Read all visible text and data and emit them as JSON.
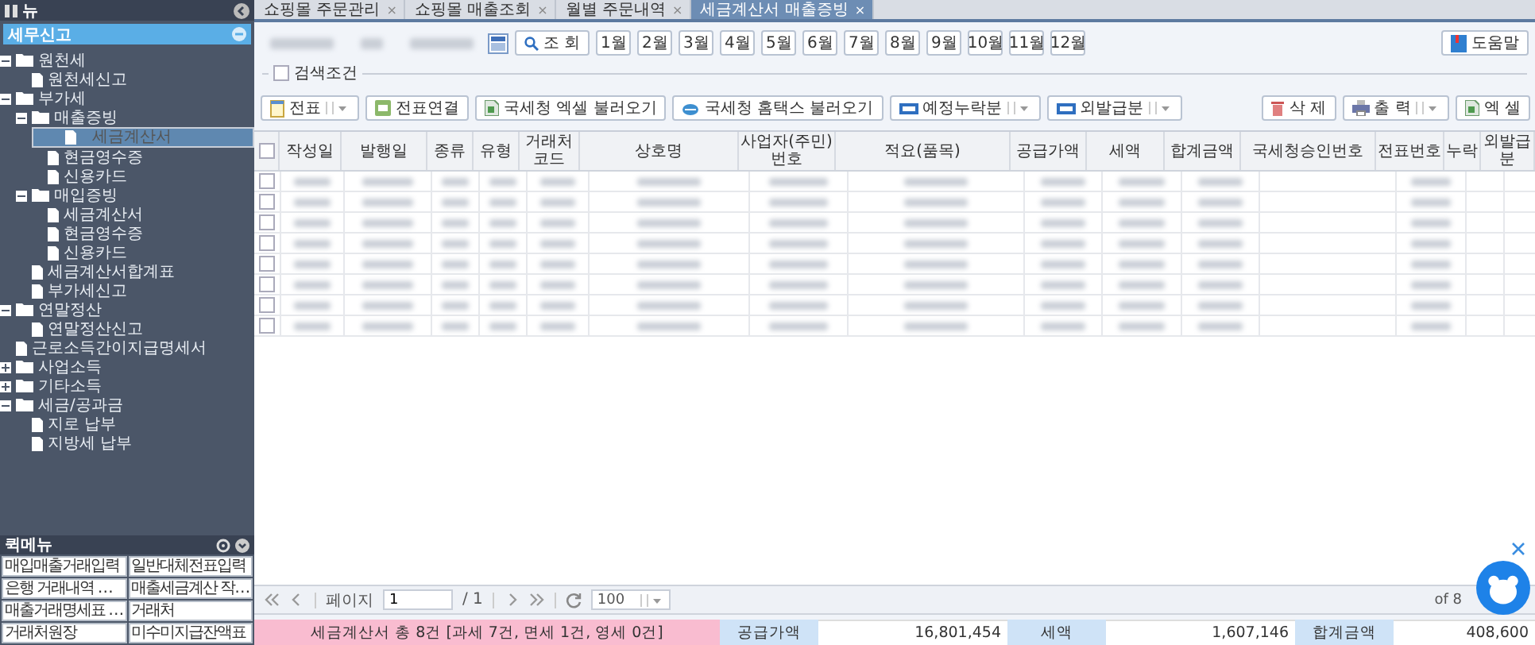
{
  "sidebar": {
    "top_label": "뉴",
    "section_title": "세무신고",
    "tree": [
      {
        "label": "원천세",
        "kind": "folder",
        "expanded": true,
        "selected": false,
        "children": [
          {
            "label": "원천세신고",
            "kind": "doc",
            "selected": false
          }
        ]
      },
      {
        "label": "부가세",
        "kind": "folder",
        "expanded": true,
        "selected": false,
        "children": [
          {
            "label": "매출증빙",
            "kind": "folder",
            "expanded": true,
            "selected": false,
            "children": [
              {
                "label": "세금계산서",
                "kind": "doc",
                "selected": true
              },
              {
                "label": "현금영수증",
                "kind": "doc",
                "selected": false
              },
              {
                "label": "신용카드",
                "kind": "doc",
                "selected": false
              }
            ]
          },
          {
            "label": "매입증빙",
            "kind": "folder",
            "expanded": true,
            "selected": false,
            "children": [
              {
                "label": "세금계산서",
                "kind": "doc",
                "selected": false
              },
              {
                "label": "현금영수증",
                "kind": "doc",
                "selected": false
              },
              {
                "label": "신용카드",
                "kind": "doc",
                "selected": false
              }
            ]
          },
          {
            "label": "세금계산서합계표",
            "kind": "doc",
            "selected": false
          },
          {
            "label": "부가세신고",
            "kind": "doc",
            "selected": false
          }
        ]
      },
      {
        "label": "연말정산",
        "kind": "folder",
        "expanded": true,
        "selected": false,
        "children": [
          {
            "label": "연말정산신고",
            "kind": "doc",
            "selected": false
          }
        ]
      },
      {
        "label": "근로소득간이지급명세서",
        "kind": "doc",
        "selected": false
      },
      {
        "label": "사업소득",
        "kind": "folder",
        "expanded": false,
        "selected": false
      },
      {
        "label": "기타소득",
        "kind": "folder",
        "expanded": false,
        "selected": false
      },
      {
        "label": "세금/공과금",
        "kind": "folder",
        "expanded": true,
        "selected": false,
        "children": [
          {
            "label": "지로 납부",
            "kind": "doc",
            "selected": false
          },
          {
            "label": "지방세 납부",
            "kind": "doc",
            "selected": false
          }
        ]
      }
    ],
    "quick_title": "퀵메뉴",
    "quick_items": [
      "매입매출거래입력",
      "일반대체전표입력",
      "은행 거래내역 …",
      "매출세금계산 작…",
      "매출거래명세표 …",
      "거래처",
      "거래처원장",
      "미수미지급잔액표"
    ]
  },
  "tabs": [
    {
      "label": "쇼핑몰 주문관리",
      "close": "×",
      "selected": false
    },
    {
      "label": "쇼핑몰 매출조회",
      "close": "×",
      "selected": false
    },
    {
      "label": "월별 주문내역",
      "close": "×",
      "selected": false
    },
    {
      "label": "세금계산서 매출증빙",
      "close": "×",
      "selected": true
    }
  ],
  "search": {
    "button": "조 회",
    "months": [
      "1월",
      "2월",
      "3월",
      "4월",
      "5월",
      "6월",
      "7월",
      "8월",
      "9월",
      "10월",
      "11월",
      "12월"
    ],
    "help": "도움말",
    "conditions_label": "검색조건",
    "conditions_checked": false
  },
  "actions": [
    {
      "label": "전표",
      "kind": "dropdown"
    },
    {
      "label": "전표연결",
      "kind": "plain"
    },
    {
      "label": "국세청 엑셀 불러오기",
      "kind": "plain"
    },
    {
      "label": "국세청 홈택스 불러오기",
      "kind": "plain"
    },
    {
      "label": "예정누락분",
      "kind": "dropdown"
    },
    {
      "label": "외발급분",
      "kind": "dropdown"
    }
  ],
  "right_actions": [
    {
      "label": "삭 제",
      "kind": "plain"
    },
    {
      "label": "출 력",
      "kind": "dropdown"
    },
    {
      "label": "엑 셀",
      "kind": "plain"
    }
  ],
  "table": {
    "all_checked": false,
    "columns": [
      {
        "label": "작성일"
      },
      {
        "label": "발행일"
      },
      {
        "label": "종류"
      },
      {
        "label": "유형"
      },
      {
        "label": "거래처코드"
      },
      {
        "label": "상호명"
      },
      {
        "label": "사업자(주민)번호"
      },
      {
        "label": "적요(품목)"
      },
      {
        "label": "공급가액"
      },
      {
        "label": "세액"
      },
      {
        "label": "합계금액"
      },
      {
        "label": "국세청승인번호"
      },
      {
        "label": "전표번호"
      },
      {
        "label": "누락"
      },
      {
        "label": "외발급분"
      }
    ],
    "rows": [
      {
        "checked": false
      },
      {
        "checked": false
      },
      {
        "checked": false
      },
      {
        "checked": false
      },
      {
        "checked": false
      },
      {
        "checked": false
      },
      {
        "checked": false
      },
      {
        "checked": false
      }
    ]
  },
  "pager": {
    "page_label": "페이지",
    "page": "1",
    "total": "/ 1",
    "page_size": "100",
    "counter": "of 8"
  },
  "summary": {
    "text": "세금계산서 총 8건 [과세 7건, 면세 1건, 영세 0건]",
    "items": [
      {
        "label": "공급가액",
        "value": "16,801,454"
      },
      {
        "label": "세액",
        "value": "1,607,146"
      },
      {
        "label": "합계금액",
        "value": "408,600"
      }
    ]
  }
}
